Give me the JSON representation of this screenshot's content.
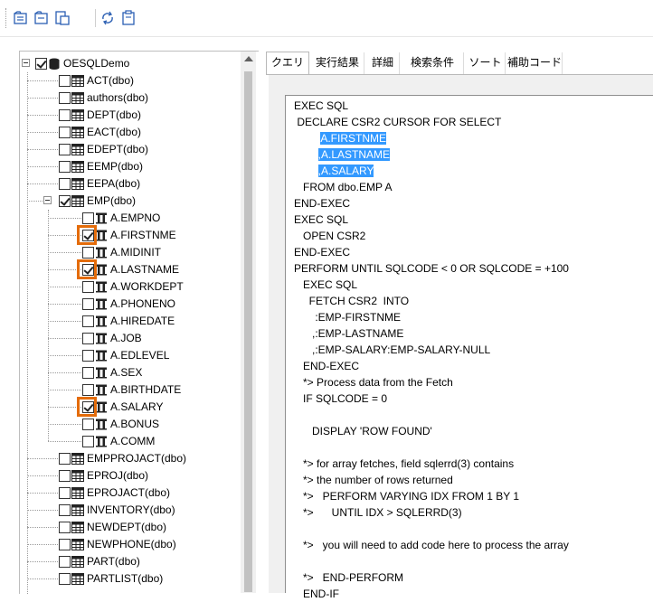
{
  "toolbar": {
    "buttons": [
      "folder-open-icon",
      "folder-save-icon",
      "copy-icon",
      "refresh-icon",
      "paste-icon"
    ]
  },
  "tree": {
    "root": "OESQLDemo",
    "tables_before": [
      "ACT(dbo)",
      "authors(dbo)",
      "DEPT(dbo)",
      "EACT(dbo)",
      "EDEPT(dbo)",
      "EEMP(dbo)",
      "EEPA(dbo)"
    ],
    "expanded_table": "EMP(dbo)",
    "columns": [
      {
        "name": "A.EMPNO",
        "checked": false
      },
      {
        "name": "A.FIRSTNME",
        "checked": true
      },
      {
        "name": "A.MIDINIT",
        "checked": false
      },
      {
        "name": "A.LASTNAME",
        "checked": true
      },
      {
        "name": "A.WORKDEPT",
        "checked": false
      },
      {
        "name": "A.PHONENO",
        "checked": false
      },
      {
        "name": "A.HIREDATE",
        "checked": false
      },
      {
        "name": "A.JOB",
        "checked": false
      },
      {
        "name": "A.EDLEVEL",
        "checked": false
      },
      {
        "name": "A.SEX",
        "checked": false
      },
      {
        "name": "A.BIRTHDATE",
        "checked": false
      },
      {
        "name": "A.SALARY",
        "checked": true
      },
      {
        "name": "A.BONUS",
        "checked": false
      },
      {
        "name": "A.COMM",
        "checked": false
      }
    ],
    "tables_after": [
      "EMPPROJACT(dbo)",
      "EPROJ(dbo)",
      "EPROJACT(dbo)",
      "INVENTORY(dbo)",
      "NEWDEPT(dbo)",
      "NEWPHONE(dbo)",
      "PART(dbo)",
      "PARTLIST(dbo)"
    ]
  },
  "tabs": [
    "クエリー",
    "実行結果",
    "詳細",
    "検索条件",
    "ソート",
    "補助コード"
  ],
  "active_tab": "クエリー",
  "code": [
    {
      "text": "EXEC SQL",
      "sel": false
    },
    {
      "text": " DECLARE CSR2 CURSOR FOR SELECT",
      "sel": false
    },
    {
      "text": "         A.FIRSTNME",
      "sel": true
    },
    {
      "text": "        ,A.LASTNAME",
      "sel": true
    },
    {
      "text": "        ,A.SALARY",
      "sel": true
    },
    {
      "text": "   FROM dbo.EMP A",
      "sel": false
    },
    {
      "text": "END-EXEC",
      "sel": false
    },
    {
      "text": "EXEC SQL",
      "sel": false
    },
    {
      "text": "   OPEN CSR2",
      "sel": false
    },
    {
      "text": "END-EXEC",
      "sel": false
    },
    {
      "text": "PERFORM UNTIL SQLCODE < 0 OR SQLCODE = +100",
      "sel": false
    },
    {
      "text": "   EXEC SQL",
      "sel": false
    },
    {
      "text": "     FETCH CSR2  INTO",
      "sel": false
    },
    {
      "text": "       :EMP-FIRSTNME",
      "sel": false
    },
    {
      "text": "      ,:EMP-LASTNAME",
      "sel": false
    },
    {
      "text": "      ,:EMP-SALARY:EMP-SALARY-NULL",
      "sel": false
    },
    {
      "text": "   END-EXEC",
      "sel": false
    },
    {
      "text": "   *> Process data from the Fetch",
      "sel": false
    },
    {
      "text": "   IF SQLCODE = 0",
      "sel": false
    },
    {
      "text": "",
      "sel": false
    },
    {
      "text": "      DISPLAY 'ROW FOUND'",
      "sel": false
    },
    {
      "text": "",
      "sel": false
    },
    {
      "text": "   *> for array fetches, field sqlerrd(3) contains",
      "sel": false
    },
    {
      "text": "   *> the number of rows returned",
      "sel": false
    },
    {
      "text": "   *>   PERFORM VARYING IDX FROM 1 BY 1",
      "sel": false
    },
    {
      "text": "   *>      UNTIL IDX > SQLERRD(3)",
      "sel": false
    },
    {
      "text": "",
      "sel": false
    },
    {
      "text": "   *>   you will need to add code here to process the array",
      "sel": false
    },
    {
      "text": "",
      "sel": false
    },
    {
      "text": "   *>   END-PERFORM",
      "sel": false
    },
    {
      "text": "   END-IF",
      "sel": false
    }
  ],
  "colors": {
    "selection": "#3399ff",
    "highlight_box": "#e46c0a"
  }
}
